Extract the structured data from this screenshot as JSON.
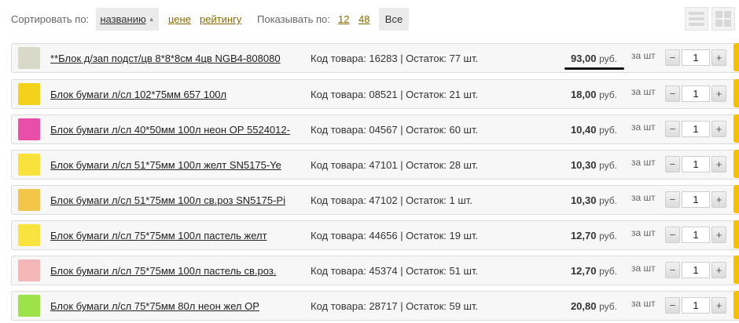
{
  "sort": {
    "label": "Сортировать по:",
    "options": [
      "названию",
      "цене",
      "рейтингу"
    ],
    "active_caret": "▲"
  },
  "show": {
    "label": "Показывать по:",
    "options": [
      "12",
      "48"
    ],
    "all_label": "Все"
  },
  "products": [
    {
      "name": "**Блок д/зап подст/цв 8*8*8см 4цв NGB4-808080",
      "meta": "Код товара: 16283 | Остаток: 77 шт.",
      "price": "93,00",
      "currency": "руб.",
      "per": "за шт",
      "qty": "1",
      "thumb_color": "#d9d9c8"
    },
    {
      "name": "Блок бумаги л/сл 102*75мм 657 100л",
      "meta": "Код товара: 08521 | Остаток: 21 шт.",
      "price": "18,00",
      "currency": "руб.",
      "per": "за шт",
      "qty": "1",
      "thumb_color": "#f4d21c"
    },
    {
      "name": "Блок бумаги л/сл 40*50мм 100л неон ОР 5524012-",
      "meta": "Код товара: 04567 | Остаток: 60 шт.",
      "price": "10,40",
      "currency": "руб.",
      "per": "за шт",
      "qty": "1",
      "thumb_color": "#e94fa8"
    },
    {
      "name": "Блок бумаги л/сл 51*75мм 100л желт SN5175-Ye",
      "meta": "Код товара: 47101 | Остаток: 28 шт.",
      "price": "10,30",
      "currency": "руб.",
      "per": "за шт",
      "qty": "1",
      "thumb_color": "#f7e13a"
    },
    {
      "name": "Блок бумаги л/сл 51*75мм 100л св.роз SN5175-Pi",
      "meta": "Код товара: 47102 | Остаток: 1 шт.",
      "price": "10,30",
      "currency": "руб.",
      "per": "за шт",
      "qty": "1",
      "thumb_color": "#f3c64a"
    },
    {
      "name": "Блок бумаги л/сл 75*75мм 100л пастель желт",
      "meta": "Код товара: 44656 | Остаток: 19 шт.",
      "price": "12,70",
      "currency": "руб.",
      "per": "за шт",
      "qty": "1",
      "thumb_color": "#f9e43f"
    },
    {
      "name": "Блок бумаги л/сл 75*75мм 100л пастель св.роз.",
      "meta": "Код товара: 45374 | Остаток: 51 шт.",
      "price": "12,70",
      "currency": "руб.",
      "per": "за шт",
      "qty": "1",
      "thumb_color": "#f5b6b8"
    },
    {
      "name": "Блок бумаги л/сл 75*75мм 80л неон жел ОР",
      "meta": "Код товара: 28717 | Остаток: 59 шт.",
      "price": "20,80",
      "currency": "руб.",
      "per": "за шт",
      "qty": "1",
      "thumb_color": "#9ee24a"
    }
  ],
  "icons": {
    "minus": "−",
    "plus": "+",
    "list_view": "list-view-icon",
    "grid_view": "grid-view-icon"
  },
  "colors": {
    "accent": "#f2c200",
    "link": "#8a6a00"
  }
}
